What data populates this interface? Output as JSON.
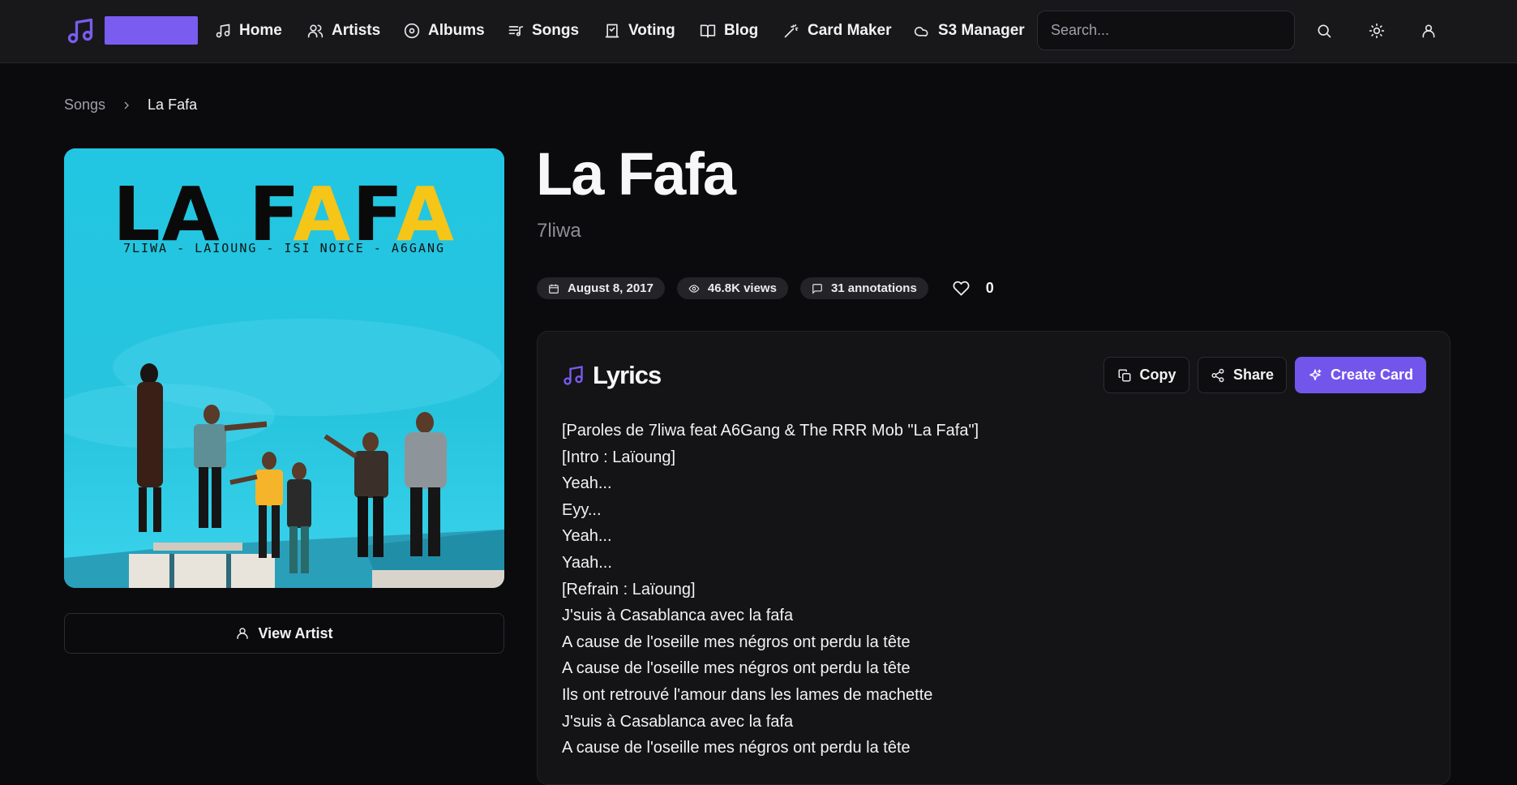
{
  "nav": {
    "items": [
      {
        "label": "Home",
        "icon": "music-note-icon"
      },
      {
        "label": "Artists",
        "icon": "users-icon"
      },
      {
        "label": "Albums",
        "icon": "disc-icon"
      },
      {
        "label": "Songs",
        "icon": "list-music-icon"
      },
      {
        "label": "Voting",
        "icon": "vote-icon"
      },
      {
        "label": "Blog",
        "icon": "book-icon"
      },
      {
        "label": "Card Maker",
        "icon": "wand-icon"
      },
      {
        "label": "S3 Manager",
        "icon": "cloud-icon"
      }
    ],
    "search_placeholder": "Search..."
  },
  "breadcrumb": {
    "parent": "Songs",
    "current": "La Fafa"
  },
  "cover": {
    "title_dark": "LA F",
    "title_yellow_1": "A",
    "title_dark_2": "F",
    "title_yellow_2": "A",
    "subtitle": "7LIWA - LAIOUNG - ISI NOICE - A6GANG",
    "accent_color": "#f5c518"
  },
  "view_artist_label": "View Artist",
  "song": {
    "title": "La Fafa",
    "artist": "7liwa",
    "date": "August 8, 2017",
    "views": "46.8K views",
    "annotations": "31 annotations",
    "likes": "0"
  },
  "lyrics": {
    "title": "Lyrics",
    "copy_label": "Copy",
    "share_label": "Share",
    "create_card_label": "Create Card",
    "lines": [
      "[Paroles de 7liwa feat A6Gang & The RRR Mob \"La Fafa\"]",
      "[Intro : Laïoung]",
      "Yeah...",
      "Eyy...",
      "Yeah...",
      "Yaah...",
      "[Refrain : Laïoung]",
      "J'suis à Casablanca avec la fafa",
      "A cause de l'oseille mes négros ont perdu la tête",
      "A cause de l'oseille mes négros ont perdu la tête",
      "Ils ont retrouvé l'amour dans les lames de machette",
      "J'suis à Casablanca avec la fafa",
      "A cause de l'oseille mes négros ont perdu la tête"
    ]
  },
  "colors": {
    "accent": "#7256ec",
    "background": "#0b0b0d",
    "card": "#141417"
  }
}
